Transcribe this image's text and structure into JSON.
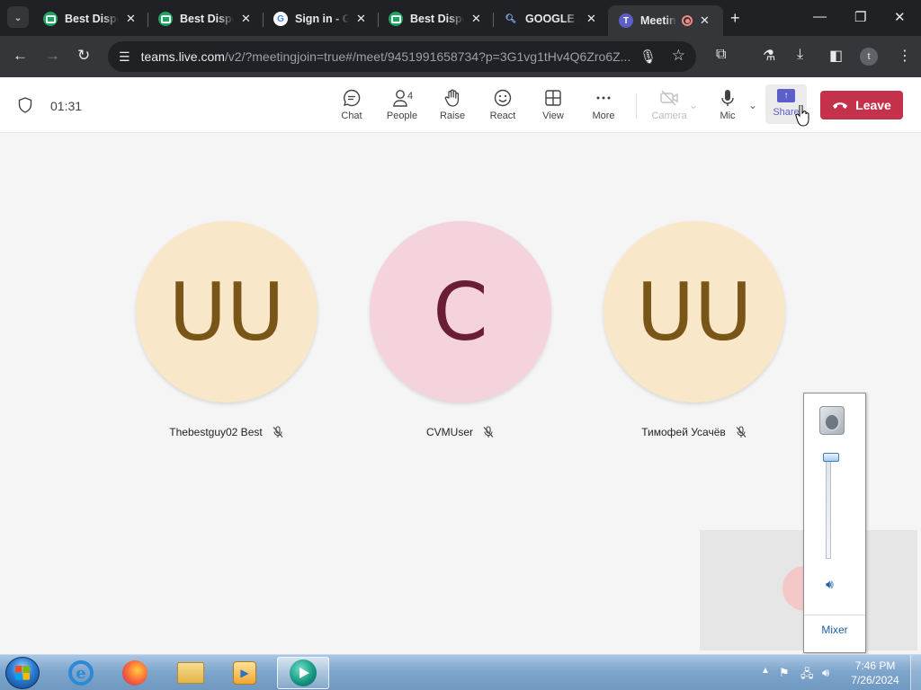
{
  "browser": {
    "tabs": [
      {
        "title": "Best Dispo",
        "favicon": "green-chat-icon"
      },
      {
        "title": "Best Dispo",
        "favicon": "green-chat-icon"
      },
      {
        "title": "Sign in - G",
        "favicon": "google-icon"
      },
      {
        "title": "Best Dispo",
        "favicon": "green-chat-icon"
      },
      {
        "title": "GOOGLE A",
        "favicon": "search-icon"
      },
      {
        "title": "Meetin",
        "favicon": "teams-icon",
        "active": true,
        "recording": true
      }
    ],
    "url_host": "teams.live.com",
    "url_path": "/v2/?meetingjoin=true#/meet/9451991658734?p=3G1vg1tHv4Q6Zro6Z...",
    "profile_initial": "t"
  },
  "meeting": {
    "timer": "01:31",
    "controls": {
      "chat": "Chat",
      "people": "People",
      "people_count": "4",
      "raise": "Raise",
      "react": "React",
      "view": "View",
      "more": "More",
      "camera": "Camera",
      "mic": "Mic",
      "share": "Share"
    },
    "leave_label": "Leave"
  },
  "participants": [
    {
      "initials": "UU",
      "name": "Thebestguy02 Best",
      "bg": "#f8e8c9",
      "fg": "#7a5518",
      "muted": true
    },
    {
      "initials": "C",
      "name": "CVMUser",
      "bg": "#f5d3dd",
      "fg": "#6b1e33",
      "muted": true
    },
    {
      "initials": "UU",
      "name": "Тимофей Усачёв",
      "bg": "#f8e8c9",
      "fg": "#7a5518",
      "muted": true
    }
  ],
  "volume_flyout": {
    "mixer_label": "Mixer"
  },
  "taskbar": {
    "apps": [
      "internet-explorer-icon",
      "firefox-icon",
      "file-explorer-icon",
      "media-player-icon",
      "teal-play-app-icon"
    ],
    "time": "7:46 PM",
    "date": "7/26/2024"
  }
}
